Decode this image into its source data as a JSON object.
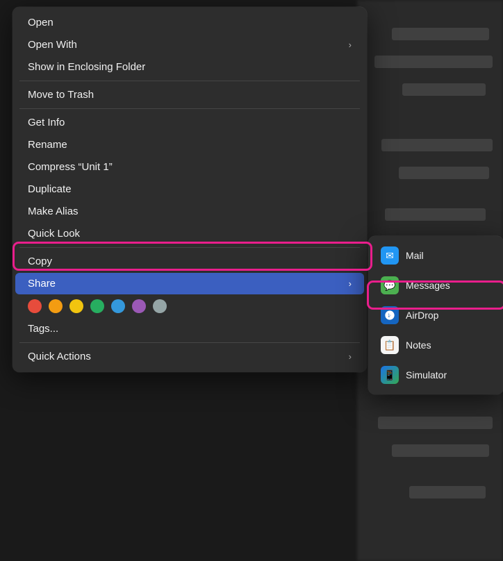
{
  "contextMenu": {
    "items": [
      {
        "id": "open",
        "label": "Open",
        "hasSubmenu": false,
        "separator_after": false
      },
      {
        "id": "open-with",
        "label": "Open With",
        "hasSubmenu": true,
        "separator_after": true
      },
      {
        "id": "show-enclosing",
        "label": "Show in Enclosing Folder",
        "hasSubmenu": false,
        "separator_after": true
      },
      {
        "id": "move-trash",
        "label": "Move to Trash",
        "hasSubmenu": false,
        "separator_after": true
      },
      {
        "id": "get-info",
        "label": "Get Info",
        "hasSubmenu": false,
        "separator_after": false
      },
      {
        "id": "rename",
        "label": "Rename",
        "hasSubmenu": false,
        "separator_after": false
      },
      {
        "id": "compress",
        "label": "Compress “Unit 1”",
        "hasSubmenu": false,
        "separator_after": false
      },
      {
        "id": "duplicate",
        "label": "Duplicate",
        "hasSubmenu": false,
        "separator_after": false
      },
      {
        "id": "make-alias",
        "label": "Make Alias",
        "hasSubmenu": false,
        "separator_after": false
      },
      {
        "id": "quick-look",
        "label": "Quick Look",
        "hasSubmenu": false,
        "separator_after": true
      },
      {
        "id": "copy",
        "label": "Copy",
        "hasSubmenu": false,
        "separator_after": false
      },
      {
        "id": "share",
        "label": "Share",
        "hasSubmenu": true,
        "active": true,
        "separator_after": false
      },
      {
        "id": "tags",
        "label": "Tags...",
        "hasSubmenu": false,
        "separator_after": true,
        "isTags": true
      },
      {
        "id": "quick-actions",
        "label": "Quick Actions",
        "hasSubmenu": true,
        "separator_after": false
      }
    ],
    "tagColors": [
      "#e74c3c",
      "#f39c12",
      "#f1c40f",
      "#27ae60",
      "#3498db",
      "#9b59b6",
      "#95a5a6"
    ]
  },
  "submenu": {
    "items": [
      {
        "id": "mail",
        "label": "Mail",
        "iconType": "mail",
        "iconEmoji": "✉"
      },
      {
        "id": "messages",
        "label": "Messages",
        "iconType": "messages",
        "iconEmoji": "💬"
      },
      {
        "id": "airdrop",
        "label": "AirDrop",
        "iconType": "airdrop",
        "iconEmoji": "📡"
      },
      {
        "id": "notes",
        "label": "Notes",
        "iconType": "notes",
        "iconEmoji": "📝"
      },
      {
        "id": "simulator",
        "label": "Simulator",
        "iconType": "simulator",
        "iconEmoji": "📱"
      }
    ]
  },
  "highlights": {
    "shareLabel": "Share",
    "airdropLabel": "AirDrop"
  },
  "chevron": "›"
}
